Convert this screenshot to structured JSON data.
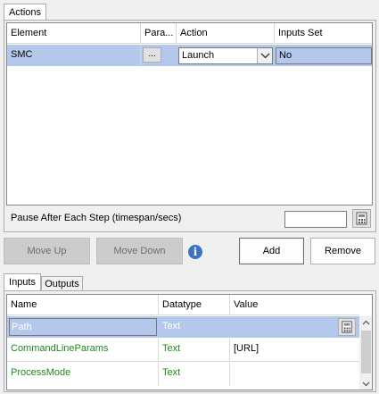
{
  "tabs_top": {
    "actions": "Actions"
  },
  "actions_grid": {
    "columns": [
      "Element",
      "Para...",
      "Action",
      "Inputs Set"
    ],
    "rows": [
      {
        "element": "SMC",
        "params_button": "...",
        "action": "Launch",
        "inputs_set": "No"
      }
    ]
  },
  "pause": {
    "label": "Pause After Each Step (timespan/secs)",
    "value": ""
  },
  "buttons": {
    "move_up": "Move Up",
    "move_down": "Move Down",
    "info": "i",
    "add": "Add",
    "remove": "Remove"
  },
  "tabs_bottom": {
    "inputs": "Inputs",
    "outputs": "Outputs"
  },
  "inputs_grid": {
    "columns": [
      "Name",
      "Datatype",
      "Value"
    ],
    "rows": [
      {
        "name": "Path",
        "datatype": "Text",
        "value": ""
      },
      {
        "name": "CommandLineParams",
        "datatype": "Text",
        "value": "[URL]"
      },
      {
        "name": "ProcessMode",
        "datatype": "Text",
        "value": ""
      }
    ]
  },
  "colors": {
    "selection": "#b4c8eb",
    "green_text": "#1d8a1d",
    "info_icon": "#3873c5"
  },
  "icons": [
    "calculator-icon",
    "info-icon",
    "chevron-down-icon",
    "scroll-up-icon",
    "scroll-down-icon"
  ]
}
